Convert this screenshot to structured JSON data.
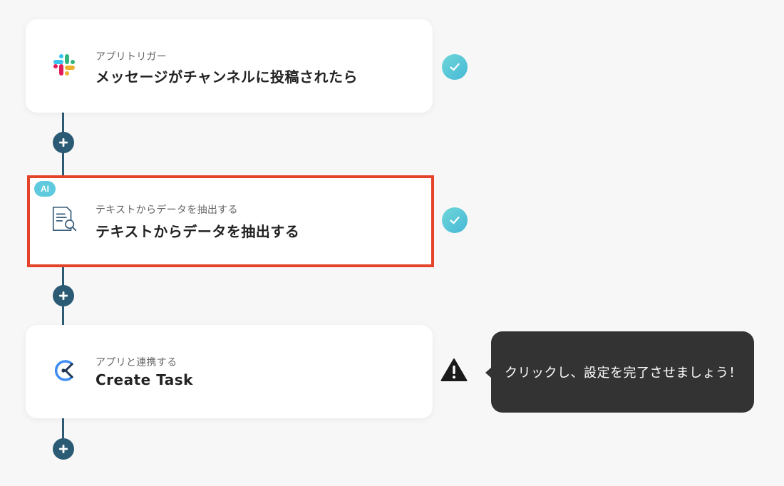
{
  "flow": {
    "steps": [
      {
        "subtitle": "アプリトリガー",
        "title": "メッセージがチャンネルに投稿されたら",
        "icon": "slack-icon",
        "status": "complete"
      },
      {
        "badge": "AI",
        "subtitle": "テキストからデータを抽出する",
        "title": "テキストからデータを抽出する",
        "icon": "document-search-icon",
        "status": "complete",
        "selected": true
      },
      {
        "subtitle": "アプリと連携する",
        "title": "Create Task",
        "icon": "clickup-icon",
        "status": "warning"
      }
    ]
  },
  "tooltip": {
    "text": "クリックし、設定を完了させましょう！"
  },
  "colors": {
    "connector": "#2d5b73",
    "selected_border": "#e4432a",
    "check_badge": "#4fc1d8",
    "ai_badge": "#5fcadd",
    "tooltip_bg": "#333333"
  }
}
